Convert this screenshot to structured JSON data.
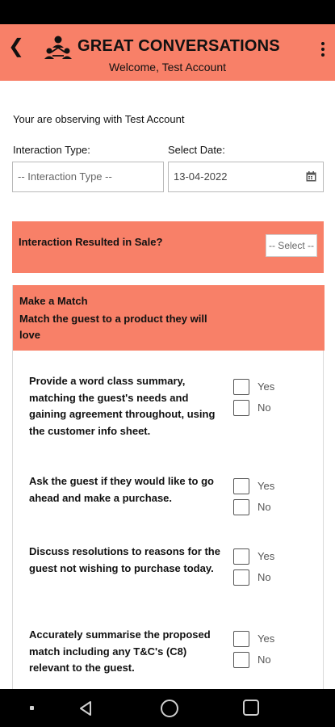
{
  "header": {
    "back_icon": "back-arrow-icon",
    "title": "GREAT CONVERSATIONS",
    "subtitle": "Welcome, Test Account",
    "menu_icon": "more-vert-icon",
    "background_color": "#f88068"
  },
  "observing_text": "Your are observing with Test Account",
  "fields": {
    "interaction_type_label": "Interaction Type:",
    "interaction_type_value": "-- Interaction Type --",
    "date_label": "Select Date:",
    "date_value": "13-04-2022",
    "date_icon": "calendar-icon"
  },
  "sale": {
    "label": "Interaction Resulted in Sale?",
    "select_value": "-- Select --"
  },
  "section": {
    "title": "Make a Match",
    "subtitle": "Match the guest to a product they will love",
    "questions": [
      {
        "text": "Provide a word class summary, matching the guest's needs and gaining agreement throughout, using the customer info sheet.",
        "yes": "Yes",
        "no": "No"
      },
      {
        "text": "Ask the guest if they would like to go ahead and make a purchase.",
        "yes": "Yes",
        "no": "No"
      },
      {
        "text": "Discuss resolutions to reasons for the guest not wishing to purchase today.",
        "yes": "Yes",
        "no": "No"
      },
      {
        "text": "Accurately summarise the proposed match including any T&C's (C8) relevant to the guest.",
        "yes": "Yes",
        "no": "No"
      }
    ]
  }
}
